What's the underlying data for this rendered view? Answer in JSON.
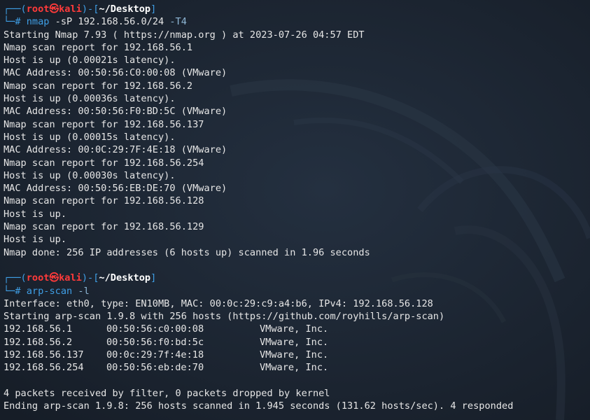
{
  "prompt": {
    "user": "root",
    "skull": "㉿",
    "host": "kali",
    "dir": "~/Desktop"
  },
  "block1": {
    "command": "nmap",
    "args": " -sP 192.168.56.0/24 ",
    "opt": "-T4",
    "output": [
      "Starting Nmap 7.93 ( https://nmap.org ) at 2023-07-26 04:57 EDT",
      "Nmap scan report for 192.168.56.1",
      "Host is up (0.00021s latency).",
      "MAC Address: 00:50:56:C0:00:08 (VMware)",
      "Nmap scan report for 192.168.56.2",
      "Host is up (0.00036s latency).",
      "MAC Address: 00:50:56:F0:BD:5C (VMware)",
      "Nmap scan report for 192.168.56.137",
      "Host is up (0.00015s latency).",
      "MAC Address: 00:0C:29:7F:4E:18 (VMware)",
      "Nmap scan report for 192.168.56.254",
      "Host is up (0.00030s latency).",
      "MAC Address: 00:50:56:EB:DE:70 (VMware)",
      "Nmap scan report for 192.168.56.128",
      "Host is up.",
      "Nmap scan report for 192.168.56.129",
      "Host is up.",
      "Nmap done: 256 IP addresses (6 hosts up) scanned in 1.96 seconds"
    ]
  },
  "block2": {
    "command": "arp-scan",
    "opt": " -l",
    "header": [
      "Interface: eth0, type: EN10MB, MAC: 00:0c:29:c9:a4:b6, IPv4: 192.168.56.128",
      "Starting arp-scan 1.9.8 with 256 hosts (https://github.com/royhills/arp-scan)"
    ],
    "rows": [
      {
        "ip": "192.168.56.1",
        "mac": "00:50:56:c0:00:08",
        "vendor": "VMware, Inc."
      },
      {
        "ip": "192.168.56.2",
        "mac": "00:50:56:f0:bd:5c",
        "vendor": "VMware, Inc."
      },
      {
        "ip": "192.168.56.137",
        "mac": "00:0c:29:7f:4e:18",
        "vendor": "VMware, Inc."
      },
      {
        "ip": "192.168.56.254",
        "mac": "00:50:56:eb:de:70",
        "vendor": "VMware, Inc."
      }
    ],
    "footer": [
      "4 packets received by filter, 0 packets dropped by kernel",
      "Ending arp-scan 1.9.8: 256 hosts scanned in 1.945 seconds (131.62 hosts/sec). 4 responded"
    ]
  }
}
